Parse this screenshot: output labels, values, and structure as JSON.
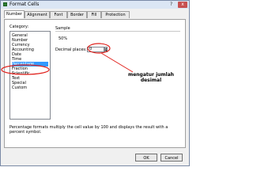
{
  "window": {
    "title": "Format Cells",
    "help_label": "?",
    "close_label": "x"
  },
  "tabs": [
    {
      "label": "Number",
      "active": true
    },
    {
      "label": "Alignment",
      "active": false
    },
    {
      "label": "Font",
      "active": false
    },
    {
      "label": "Border",
      "active": false
    },
    {
      "label": "Fill",
      "active": false
    },
    {
      "label": "Protection",
      "active": false
    }
  ],
  "category": {
    "label": "Category:",
    "items": [
      "General",
      "Number",
      "Currency",
      "Accounting",
      "Date",
      "Time",
      "Percentage",
      "Fraction",
      "Scientific",
      "Text",
      "Special",
      "Custom"
    ],
    "selected": "Percentage"
  },
  "sample": {
    "label": "Sample",
    "value": "50%"
  },
  "decimal_places": {
    "label": "Decimal places:",
    "value": "0"
  },
  "annotation": {
    "line1": "mengatur jumlah",
    "line2": "desimal",
    "color": "#e0201b"
  },
  "description": "Percentage formats multiply the cell value by 100 and displays the result with a percent symbol.",
  "buttons": {
    "ok": "OK",
    "cancel": "Cancel"
  },
  "colors": {
    "selection": "#3399ff",
    "title_bar": "#dbe6f4",
    "close_button": "#c75050"
  }
}
